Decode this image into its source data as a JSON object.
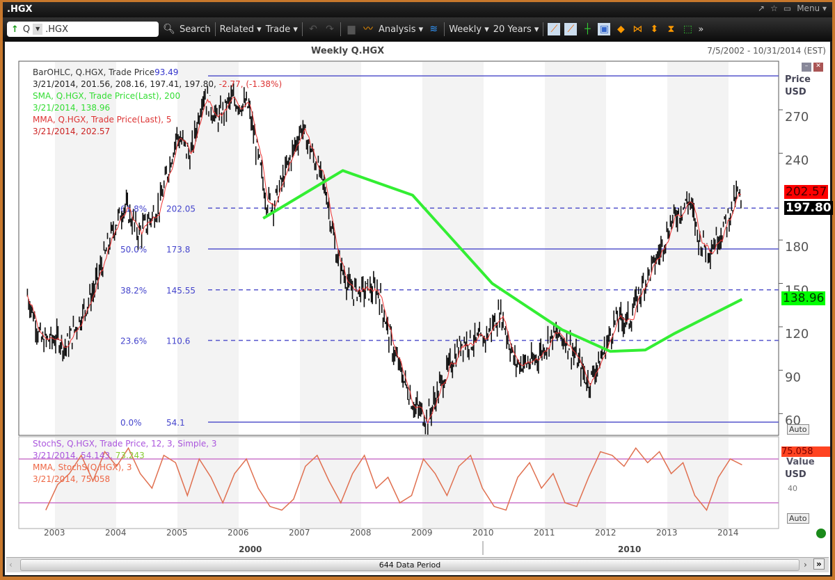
{
  "window": {
    "title": ".HGX",
    "controls": [
      "↗",
      "☆",
      "▭",
      "Menu ▾"
    ]
  },
  "toolbar": {
    "arrow": "↑",
    "prefix": "Q",
    "symbol": ".HGX",
    "search": "Search",
    "related": "Related ▾",
    "trade": "Trade ▾",
    "analysis": "Analysis ▾",
    "interval": "Weekly ▾",
    "range": "20 Years ▾",
    "more": "»"
  },
  "chart": {
    "title": "Weekly Q.HGX",
    "date_range": "7/5/2002 - 10/31/2014 (EST)",
    "legend": {
      "bar_label": "BarOHLC, Q.HGX, Trade Price",
      "bar_top": "93.49",
      "bar_values": "3/21/2014, 201.56, 208.16, 197.41, 197.80,",
      "bar_change": "-2.77, (-1.38%)",
      "sma_label": "SMA, Q.HGX, Trade Price(Last),  200",
      "sma_values": "3/21/2014, 138.96",
      "mma_label": "MMA, Q.HGX, Trade Price(Last),  5",
      "mma_values": "3/21/2014, 202.57"
    },
    "axis_title": "Price",
    "axis_unit": "USD",
    "auto": "Auto",
    "price_badges": {
      "mma": "202.57",
      "last": "197.80",
      "sma": "138.96"
    },
    "stoch_legend": {
      "label": "StochS, Q.HGX, Trade Price,  12, 3, Simple, 3",
      "values": "3/21/2014, 54.143,",
      "k": "73.243",
      "mma_label": "MMA, StochS(Q.HGX),  3",
      "mma_values": "3/21/2014, 75.058"
    },
    "stoch_axis_title": "Value",
    "stoch_axis_unit": "USD",
    "stoch_badge": "75.058",
    "stoch_auto": "Auto",
    "years": [
      "2003",
      "2004",
      "2005",
      "2006",
      "2007",
      "2008",
      "2009",
      "2010",
      "2011",
      "2012",
      "2013",
      "2014"
    ],
    "decades": [
      "2000",
      "2010"
    ],
    "scrollbar": "644 Data Period"
  },
  "chart_data": {
    "type": "line",
    "title": "Weekly Q.HGX",
    "ylabel": "Price USD",
    "ylim": [
      50,
      300
    ],
    "yticks": [
      60,
      90,
      120,
      150,
      180,
      240,
      270
    ],
    "fib_levels": [
      {
        "pct": "0.0%",
        "value": "54.1",
        "style": "solid"
      },
      {
        "pct": "23.6%",
        "value": "110.6",
        "style": "dashed"
      },
      {
        "pct": "38.2%",
        "value": "145.55",
        "style": "dashed"
      },
      {
        "pct": "50.0%",
        "value": "173.8",
        "style": "solid"
      },
      {
        "pct": "61.8%",
        "value": "202.05",
        "style": "dashed"
      },
      {
        "pct": "",
        "value": "293.49",
        "style": "solid"
      }
    ],
    "price": {
      "x": [
        2002.55,
        2002.78,
        2003.06,
        2003.17,
        2003.63,
        2003.97,
        2004.14,
        2004.37,
        2004.71,
        2004.99,
        2005.22,
        2005.42,
        2005.65,
        2005.88,
        2006.16,
        2006.45,
        2006.57,
        2007.03,
        2007.26,
        2007.43,
        2007.6,
        2007.83,
        2008.06,
        2008.28,
        2008.51,
        2008.85,
        2009.08,
        2009.31,
        2009.65,
        2009.99,
        2010.28,
        2010.51,
        2010.8,
        2011.14,
        2011.37,
        2011.71,
        2011.94,
        2012.16,
        2012.39,
        2012.56,
        2012.85,
        2013.08,
        2013.36,
        2013.53,
        2013.7,
        2013.93,
        2014.16,
        2014.22
      ],
      "y": [
        142,
        110,
        112,
        105,
        145,
        189,
        204,
        184,
        204,
        253,
        238,
        282,
        263,
        277,
        272,
        208,
        204,
        258,
        233,
        213,
        169,
        145,
        145,
        145,
        105,
        66,
        56,
        81,
        110,
        110,
        130,
        95,
        95,
        115,
        110,
        81,
        100,
        125,
        125,
        145,
        169,
        194,
        208,
        179,
        174,
        189,
        213,
        198
      ]
    },
    "sma200": {
      "x": [
        2006.4,
        2007.7,
        2008.84,
        2010.14,
        2011.28,
        2012.07,
        2012.64,
        2013.1,
        2014.22
      ],
      "y": [
        195,
        228,
        211,
        150,
        118,
        103,
        104,
        115,
        139
      ]
    },
    "stoch": {
      "y": [
        10,
        45,
        60,
        85,
        50,
        90,
        70,
        95,
        60,
        40,
        85,
        75,
        30,
        80,
        55,
        20,
        60,
        80,
        40,
        15,
        10,
        25,
        70,
        85,
        50,
        20,
        60,
        85,
        40,
        55,
        20,
        30,
        80,
        60,
        30,
        70,
        85,
        40,
        15,
        10,
        55,
        75,
        40,
        60,
        20,
        15,
        55,
        90,
        85,
        70,
        95,
        75,
        90,
        60,
        75,
        30,
        10,
        55,
        80,
        72
      ]
    }
  }
}
